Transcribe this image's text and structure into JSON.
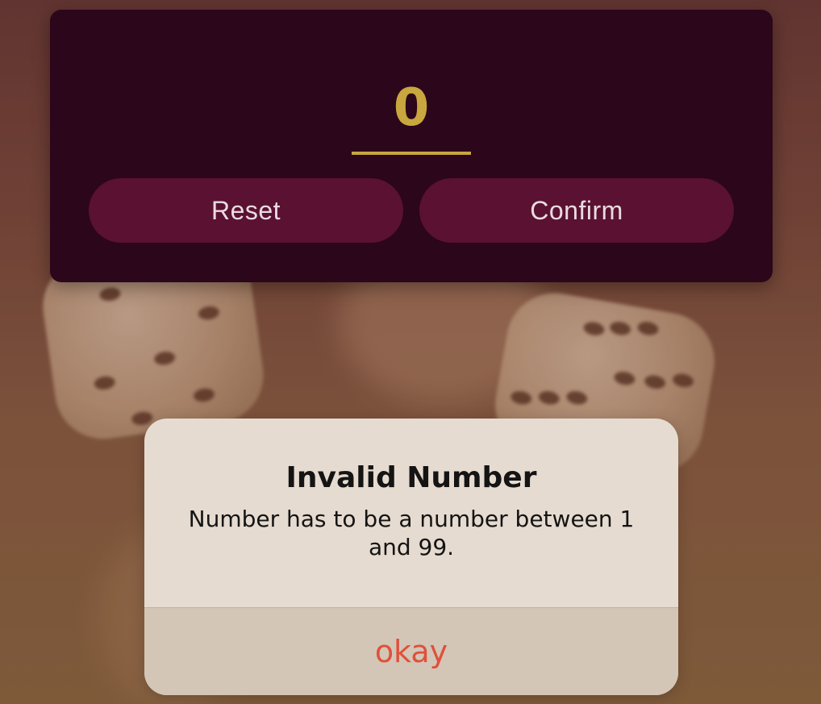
{
  "input": {
    "value": "0"
  },
  "buttons": {
    "reset_label": "Reset",
    "confirm_label": "Confirm"
  },
  "alert": {
    "title": "Invalid Number",
    "message": "Number has to be a number between 1 and 99.",
    "action_label": "okay"
  },
  "colors": {
    "card_background": "#2c061b",
    "button_background": "#5a1132",
    "accent_gold": "#c9a63e",
    "alert_action": "#e0503a"
  }
}
